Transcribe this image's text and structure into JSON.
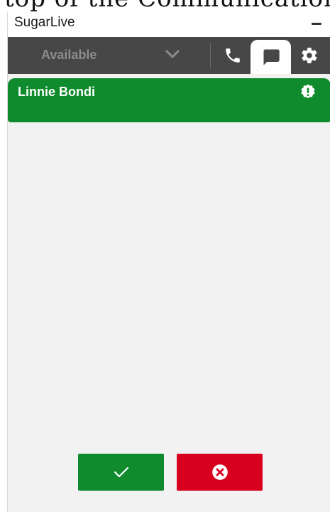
{
  "background_doc": {
    "text": "top of the Communication pa"
  },
  "window": {
    "title": "SugarLive",
    "minimize_icon": "minimize-icon"
  },
  "toolbar": {
    "status": "Available",
    "status_icon": "chevron-down-icon",
    "buttons": [
      {
        "icon": "phone-icon",
        "active": false
      },
      {
        "icon": "chat-icon",
        "active": true
      },
      {
        "icon": "gear-icon",
        "active": false
      }
    ]
  },
  "contact": {
    "name": "Linnie Bondi",
    "icon": "alert-badge-icon",
    "color": "#0f8a2c"
  },
  "actions": {
    "accept_icon": "checkmark-icon",
    "accept_color": "#0f8a2c",
    "decline_icon": "close-circle-icon",
    "decline_color": "#d7001f"
  },
  "colors": {
    "toolbar": "#474747",
    "panel": "#f2f2f2"
  }
}
